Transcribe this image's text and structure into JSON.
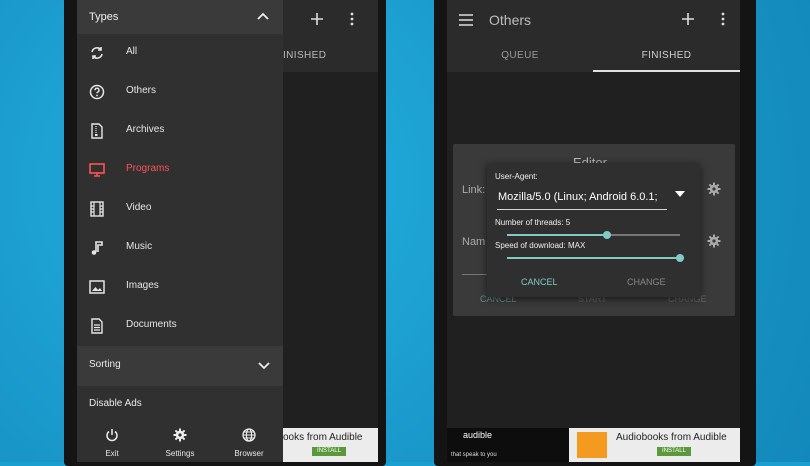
{
  "left_phone": {
    "tab_finished_partial": "INISHED",
    "drawer": {
      "header": "Types",
      "items": [
        {
          "label": "All",
          "icon": "sync-icon"
        },
        {
          "label": "Others",
          "icon": "help-circle-icon"
        },
        {
          "label": "Archives",
          "icon": "archive-file-icon"
        },
        {
          "label": "Programs",
          "icon": "monitor-icon",
          "active": true
        },
        {
          "label": "Video",
          "icon": "film-icon"
        },
        {
          "label": "Music",
          "icon": "music-note-icon"
        },
        {
          "label": "Images",
          "icon": "image-icon"
        },
        {
          "label": "Documents",
          "icon": "document-icon"
        }
      ],
      "sorting_label": "Sorting",
      "disable_ads_label": "Disable Ads",
      "bottom": [
        {
          "label": "Exit",
          "icon": "power-icon"
        },
        {
          "label": "Settings",
          "icon": "gear-icon"
        },
        {
          "label": "Browser",
          "icon": "globe-icon"
        }
      ]
    },
    "ad_text": "ooks from Audible",
    "ad_install": "INSTALL"
  },
  "right_phone": {
    "title": "Others",
    "tabs": [
      "QUEUE",
      "FINISHED"
    ],
    "back_dialog": {
      "title": "Editor",
      "link_label": "Link:",
      "name_label": "Nam",
      "buttons": [
        "CANCEL",
        "START",
        "CHANGE"
      ]
    },
    "front_dialog": {
      "user_agent_label": "User-Agent:",
      "user_agent_value": "Mozilla/5.0 (Linux; Android 6.0.1;",
      "threads_label": "Number of threads: 5",
      "threads_fraction": 0.58,
      "speed_label": "Speed of download: MAX",
      "speed_fraction": 1.0,
      "cancel_label": "CANCEL",
      "change_label": "CHANGE"
    },
    "ad_left_brand": "audible",
    "ad_left_sub": "that speak to you",
    "ad_text": "Audiobooks from Audible",
    "ad_install": "INSTALL"
  },
  "colors": {
    "accent_red": "#ff5252",
    "accent_teal": "#80cbc4",
    "background_blue": "#1a9fd0"
  }
}
